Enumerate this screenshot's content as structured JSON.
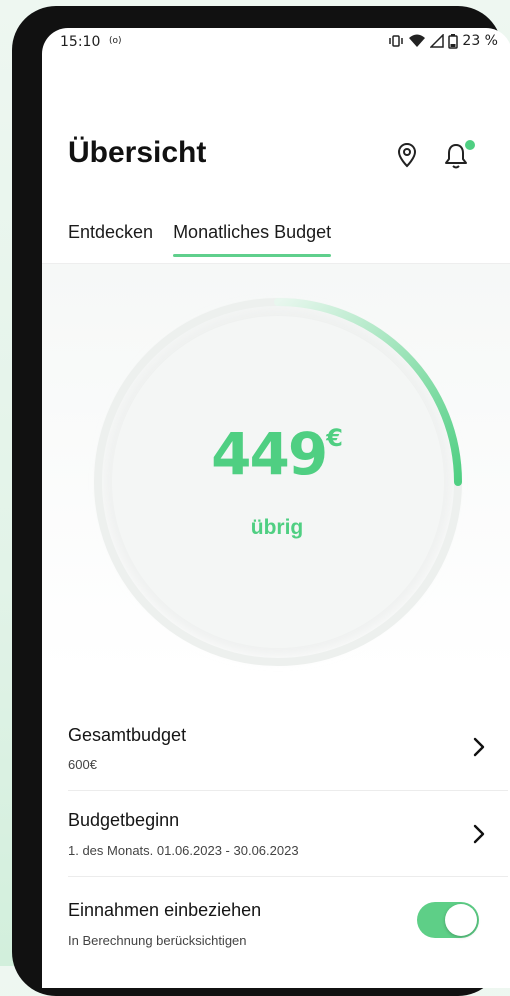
{
  "status_bar": {
    "time": "15:10",
    "radio_indicator": "(o)",
    "battery": "23 %"
  },
  "header": {
    "title": "Übersicht",
    "icons": [
      "location-pin-icon",
      "bell-icon"
    ]
  },
  "tabs": [
    {
      "label": "Entdecken",
      "active": false
    },
    {
      "label": "Monatliches Budget",
      "active": true
    }
  ],
  "budget": {
    "amount": "449",
    "currency": "€",
    "label": "übrig",
    "remaining_fraction": 0.75
  },
  "settings": {
    "total": {
      "title": "Gesamtbudget",
      "value": "600€"
    },
    "start": {
      "title": "Budgetbeginn",
      "value": "1. des Monats. 01.06.2023 - 30.06.2023"
    },
    "income": {
      "title": "Einnahmen einbeziehen",
      "subtitle": "In Berechnung berücksichtigen",
      "enabled": true
    }
  },
  "colors": {
    "accent": "#4fcf82",
    "text": "#151515"
  }
}
